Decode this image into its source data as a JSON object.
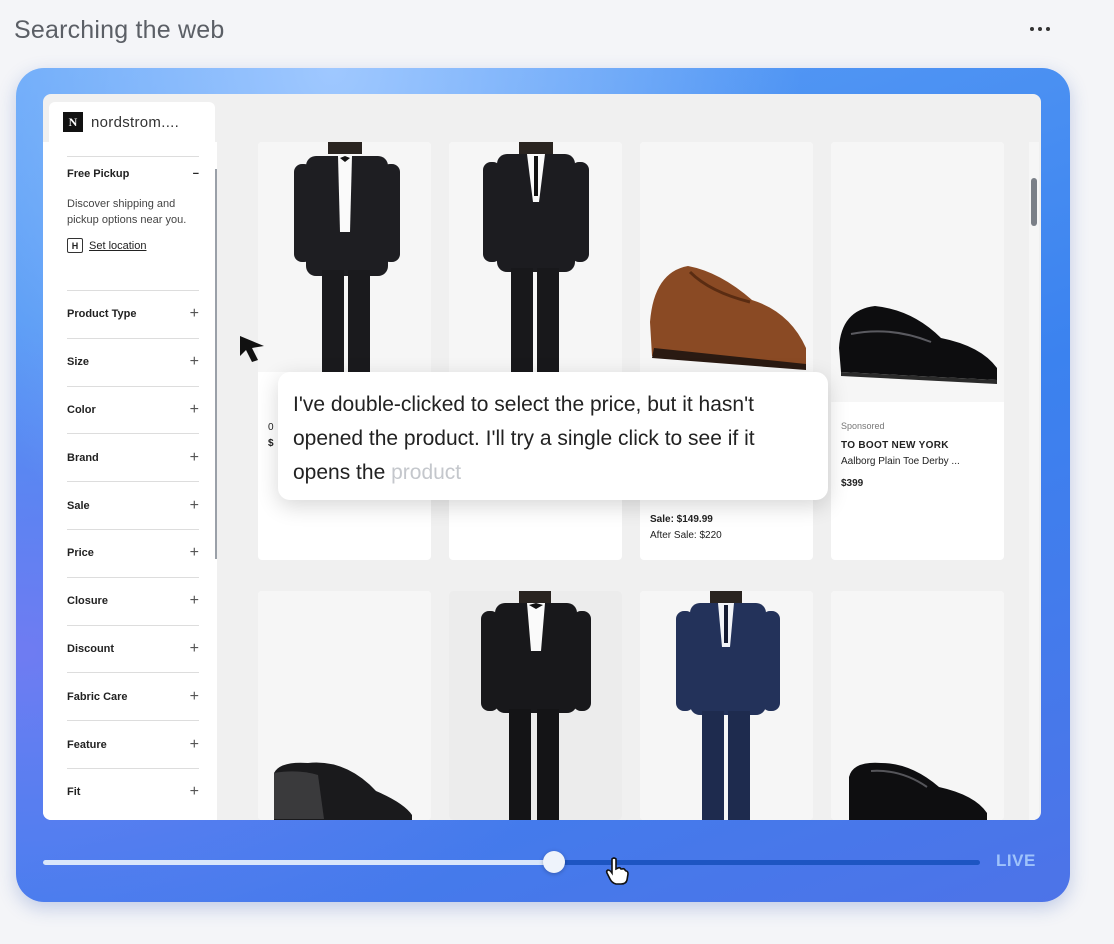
{
  "header": {
    "title": "Searching the web",
    "more_icon": "ellipsis-icon"
  },
  "browser": {
    "tab_label": "nordstrom....",
    "favicon_letter": "N"
  },
  "sidebar": {
    "free_pickup": {
      "title": "Free Pickup",
      "toggle": "−",
      "text": "Discover shipping and pickup options near you.",
      "location_icon": "store-icon",
      "location_icon_glyph": "H",
      "location_link": "Set location"
    },
    "filters": [
      {
        "label": "Product Type",
        "icon": "+"
      },
      {
        "label": "Size",
        "icon": "+"
      },
      {
        "label": "Color",
        "icon": "+"
      },
      {
        "label": "Brand",
        "icon": "+"
      },
      {
        "label": "Sale",
        "icon": "+"
      },
      {
        "label": "Price",
        "icon": "+"
      },
      {
        "label": "Closure",
        "icon": "+"
      },
      {
        "label": "Discount",
        "icon": "+"
      },
      {
        "label": "Fabric Care",
        "icon": "+"
      },
      {
        "label": "Feature",
        "icon": "+"
      },
      {
        "label": "Fit",
        "icon": "+"
      }
    ]
  },
  "products": [
    {
      "image": "black-tuxedo",
      "cut_off_text": [
        "0",
        "$"
      ]
    },
    {
      "image": "black-suit"
    },
    {
      "image": "brown-derby-shoe",
      "sale": "Sale: $149.99",
      "after_sale": "After Sale: $220"
    },
    {
      "image": "black-patent-derby-shoe",
      "sponsored": "Sponsored",
      "brand": "TO BOOT NEW YORK",
      "name": "Aalborg Plain Toe Derby ...",
      "price": "$399"
    },
    {
      "image": "black-loafer-shoe"
    },
    {
      "image": "black-tuxedo-gray-background"
    },
    {
      "image": "navy-suit"
    },
    {
      "image": "black-patent-oxford-shoe"
    }
  ],
  "tooltip": {
    "text": "I've double-clicked to select the price, but it hasn't opened the product. I'll try a single click to see if it opens the",
    "fading_text": "product"
  },
  "timeline": {
    "progress": 0.545,
    "live_label": "LIVE"
  },
  "colors": {
    "frame_blue": "#3b82ef",
    "timeline_dark": "#1d55c2",
    "live_text": "#9fc3fb"
  }
}
